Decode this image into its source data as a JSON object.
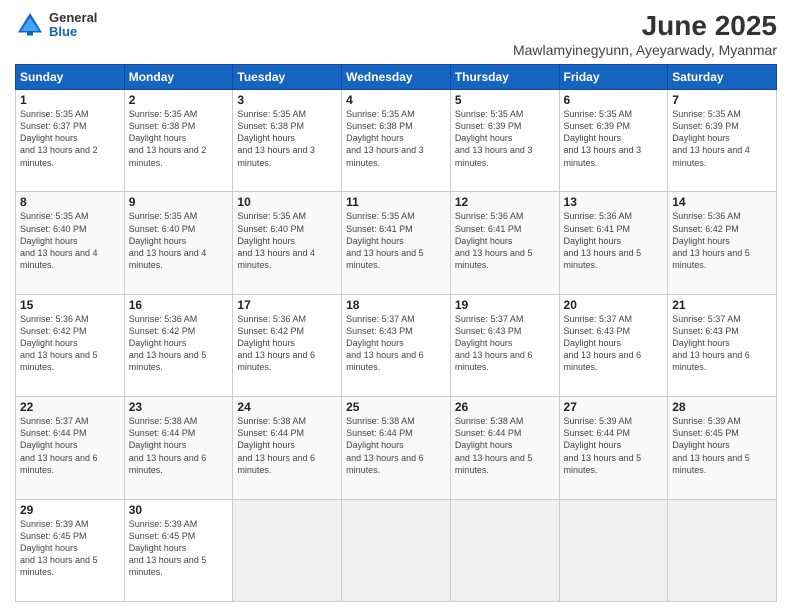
{
  "logo": {
    "general": "General",
    "blue": "Blue"
  },
  "title": "June 2025",
  "subtitle": "Mawlamyinegyunn, Ayeyarwady, Myanmar",
  "weekdays": [
    "Sunday",
    "Monday",
    "Tuesday",
    "Wednesday",
    "Thursday",
    "Friday",
    "Saturday"
  ],
  "weeks": [
    [
      {
        "day": 1,
        "sunrise": "5:35 AM",
        "sunset": "6:37 PM",
        "daylight": "13 hours and 2 minutes."
      },
      {
        "day": 2,
        "sunrise": "5:35 AM",
        "sunset": "6:38 PM",
        "daylight": "13 hours and 2 minutes."
      },
      {
        "day": 3,
        "sunrise": "5:35 AM",
        "sunset": "6:38 PM",
        "daylight": "13 hours and 3 minutes."
      },
      {
        "day": 4,
        "sunrise": "5:35 AM",
        "sunset": "6:38 PM",
        "daylight": "13 hours and 3 minutes."
      },
      {
        "day": 5,
        "sunrise": "5:35 AM",
        "sunset": "6:39 PM",
        "daylight": "13 hours and 3 minutes."
      },
      {
        "day": 6,
        "sunrise": "5:35 AM",
        "sunset": "6:39 PM",
        "daylight": "13 hours and 3 minutes."
      },
      {
        "day": 7,
        "sunrise": "5:35 AM",
        "sunset": "6:39 PM",
        "daylight": "13 hours and 4 minutes."
      }
    ],
    [
      {
        "day": 8,
        "sunrise": "5:35 AM",
        "sunset": "6:40 PM",
        "daylight": "13 hours and 4 minutes."
      },
      {
        "day": 9,
        "sunrise": "5:35 AM",
        "sunset": "6:40 PM",
        "daylight": "13 hours and 4 minutes."
      },
      {
        "day": 10,
        "sunrise": "5:35 AM",
        "sunset": "6:40 PM",
        "daylight": "13 hours and 4 minutes."
      },
      {
        "day": 11,
        "sunrise": "5:35 AM",
        "sunset": "6:41 PM",
        "daylight": "13 hours and 5 minutes."
      },
      {
        "day": 12,
        "sunrise": "5:36 AM",
        "sunset": "6:41 PM",
        "daylight": "13 hours and 5 minutes."
      },
      {
        "day": 13,
        "sunrise": "5:36 AM",
        "sunset": "6:41 PM",
        "daylight": "13 hours and 5 minutes."
      },
      {
        "day": 14,
        "sunrise": "5:36 AM",
        "sunset": "6:42 PM",
        "daylight": "13 hours and 5 minutes."
      }
    ],
    [
      {
        "day": 15,
        "sunrise": "5:36 AM",
        "sunset": "6:42 PM",
        "daylight": "13 hours and 5 minutes."
      },
      {
        "day": 16,
        "sunrise": "5:36 AM",
        "sunset": "6:42 PM",
        "daylight": "13 hours and 5 minutes."
      },
      {
        "day": 17,
        "sunrise": "5:36 AM",
        "sunset": "6:42 PM",
        "daylight": "13 hours and 6 minutes."
      },
      {
        "day": 18,
        "sunrise": "5:37 AM",
        "sunset": "6:43 PM",
        "daylight": "13 hours and 6 minutes."
      },
      {
        "day": 19,
        "sunrise": "5:37 AM",
        "sunset": "6:43 PM",
        "daylight": "13 hours and 6 minutes."
      },
      {
        "day": 20,
        "sunrise": "5:37 AM",
        "sunset": "6:43 PM",
        "daylight": "13 hours and 6 minutes."
      },
      {
        "day": 21,
        "sunrise": "5:37 AM",
        "sunset": "6:43 PM",
        "daylight": "13 hours and 6 minutes."
      }
    ],
    [
      {
        "day": 22,
        "sunrise": "5:37 AM",
        "sunset": "6:44 PM",
        "daylight": "13 hours and 6 minutes."
      },
      {
        "day": 23,
        "sunrise": "5:38 AM",
        "sunset": "6:44 PM",
        "daylight": "13 hours and 6 minutes."
      },
      {
        "day": 24,
        "sunrise": "5:38 AM",
        "sunset": "6:44 PM",
        "daylight": "13 hours and 6 minutes."
      },
      {
        "day": 25,
        "sunrise": "5:38 AM",
        "sunset": "6:44 PM",
        "daylight": "13 hours and 6 minutes."
      },
      {
        "day": 26,
        "sunrise": "5:38 AM",
        "sunset": "6:44 PM",
        "daylight": "13 hours and 5 minutes."
      },
      {
        "day": 27,
        "sunrise": "5:39 AM",
        "sunset": "6:44 PM",
        "daylight": "13 hours and 5 minutes."
      },
      {
        "day": 28,
        "sunrise": "5:39 AM",
        "sunset": "6:45 PM",
        "daylight": "13 hours and 5 minutes."
      }
    ],
    [
      {
        "day": 29,
        "sunrise": "5:39 AM",
        "sunset": "6:45 PM",
        "daylight": "13 hours and 5 minutes."
      },
      {
        "day": 30,
        "sunrise": "5:39 AM",
        "sunset": "6:45 PM",
        "daylight": "13 hours and 5 minutes."
      },
      null,
      null,
      null,
      null,
      null
    ]
  ]
}
